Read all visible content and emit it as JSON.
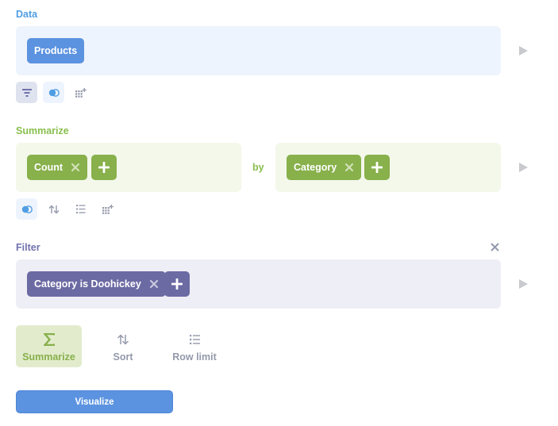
{
  "data_step": {
    "title": "Data",
    "source_label": "Products"
  },
  "summarize_step": {
    "title": "Summarize",
    "metric_label": "Count",
    "by_label": "by",
    "breakout_label": "Category"
  },
  "filter_step": {
    "title": "Filter",
    "filter_label": "Category is Doohickey"
  },
  "actions": {
    "summarize_label": "Summarize",
    "sort_label": "Sort",
    "row_limit_label": "Row limit"
  },
  "visualize_label": "Visualize",
  "colors": {
    "data": "#509ee3",
    "summarize": "#88bf4d",
    "filter": "#7172ad"
  },
  "icons": [
    "filter-icon",
    "join-icon",
    "custom-column-icon",
    "sort-icon",
    "row-limit-icon",
    "sigma-icon",
    "close-icon",
    "plus-icon",
    "play-icon"
  ]
}
